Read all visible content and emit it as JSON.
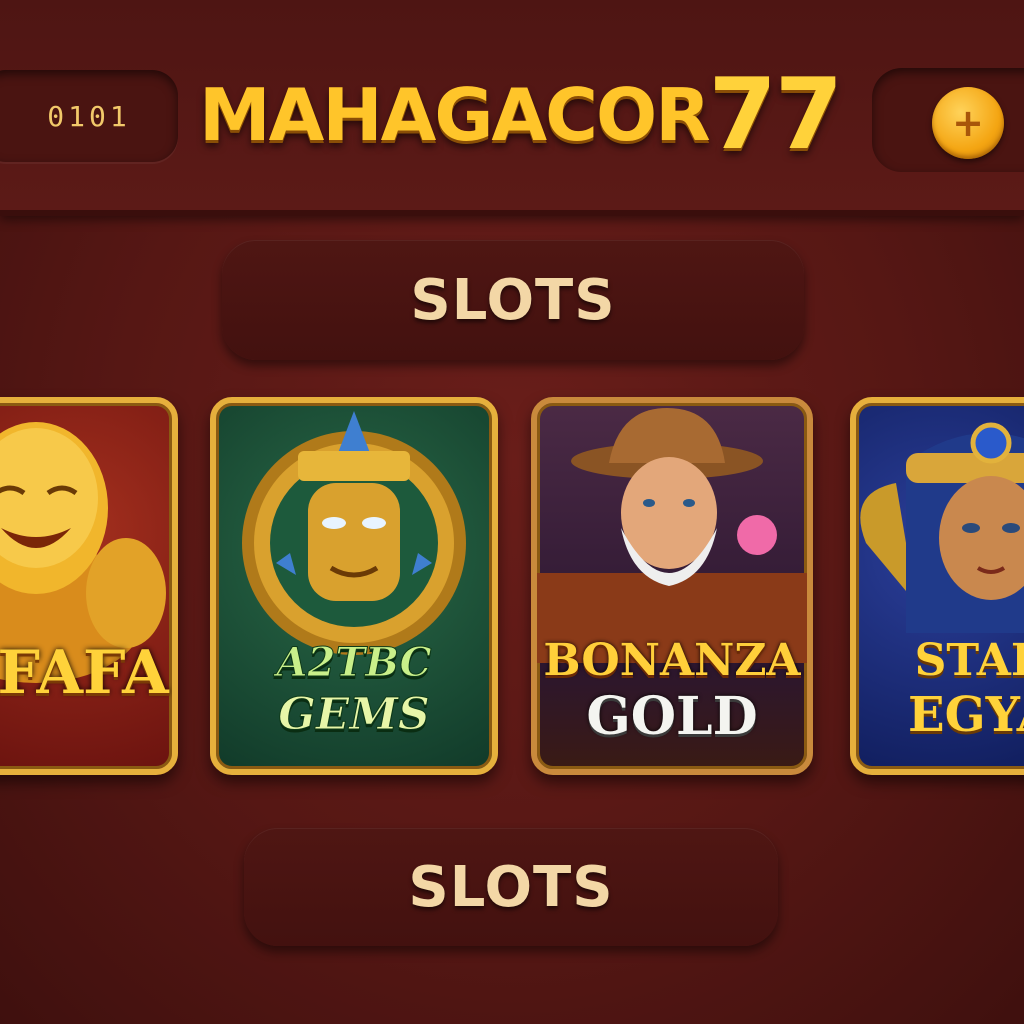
{
  "header": {
    "balance": "0101",
    "logo": "MAHAGACOR",
    "logo_number": "77",
    "add_symbol": "+"
  },
  "sections": {
    "top_label": "SLOTS",
    "bottom_label": "SLOTS"
  },
  "games": [
    {
      "title_line1": "FAFA",
      "title_line2": ""
    },
    {
      "title_line1": "A2TBC",
      "title_line2": "GEMS"
    },
    {
      "title_line1": "BONANZA",
      "title_line2": "GOLD"
    },
    {
      "title_line1": "STAR",
      "title_line2": "EGYA"
    }
  ],
  "colors": {
    "background": "#561714",
    "gold": "#ffc52a",
    "label": "#f3d7a6",
    "card_border": "#e6b03c"
  }
}
